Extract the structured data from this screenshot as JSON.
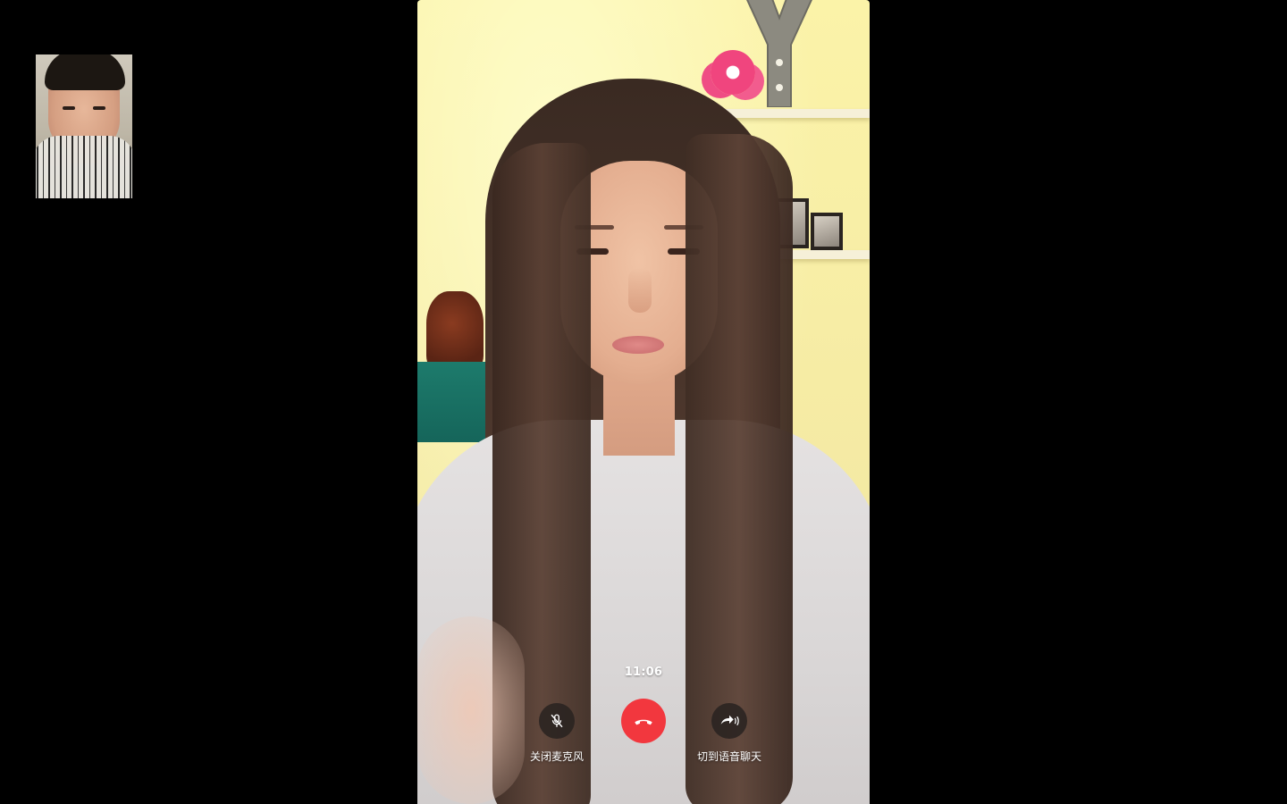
{
  "call": {
    "timer": "11:06",
    "controls": {
      "mute": {
        "label": "关闭麦克风",
        "icon": "microphone-off-icon"
      },
      "hangup": {
        "icon": "phone-hangup-icon",
        "color": "#f2373e"
      },
      "voice": {
        "label": "切到语音聊天",
        "icon": "switch-to-voice-icon"
      }
    }
  },
  "colors": {
    "background": "#000000",
    "hangup_red": "#f2373e",
    "control_button": "#282220"
  }
}
